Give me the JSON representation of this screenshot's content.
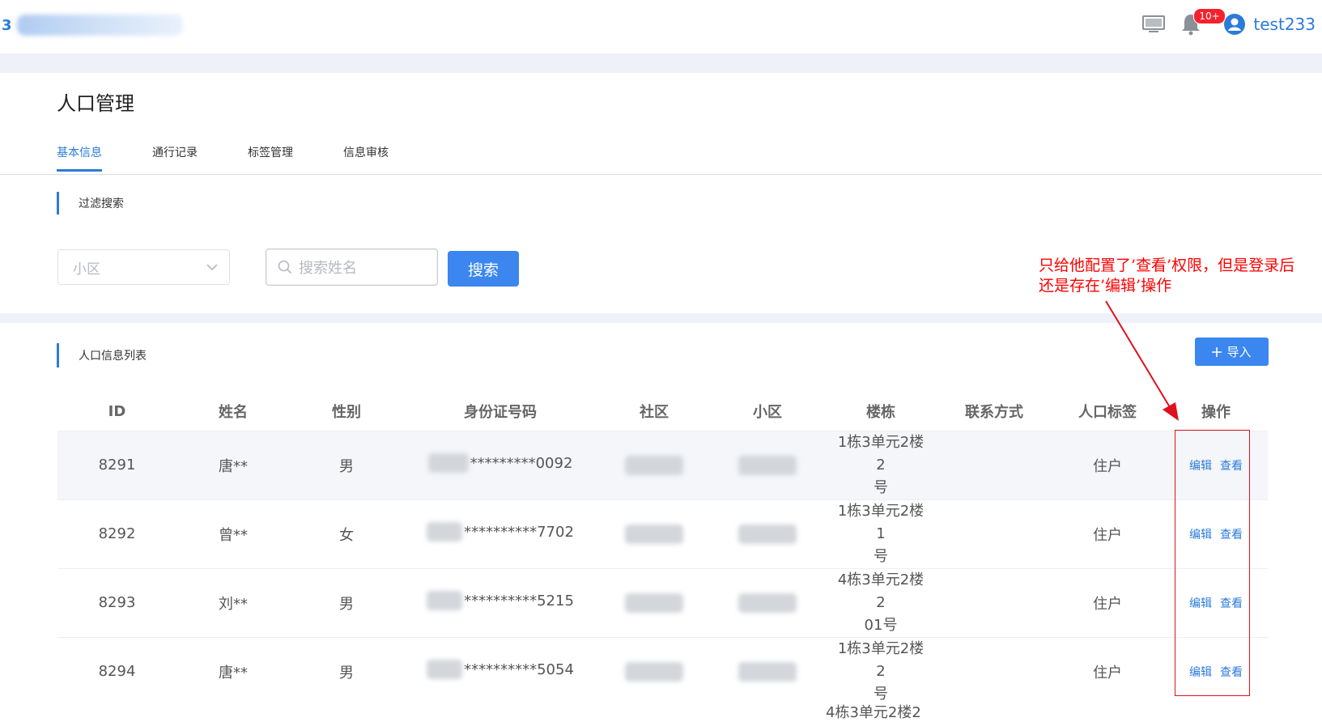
{
  "header": {
    "logo_text": "3",
    "badge": "10+",
    "username": "test233"
  },
  "page": {
    "title": "人口管理",
    "tabs": [
      "基本信息",
      "通行记录",
      "标签管理",
      "信息审核"
    ],
    "active_tab": 0
  },
  "filter": {
    "section_label": "过滤搜索",
    "community_placeholder": "小区",
    "name_placeholder": "搜索姓名",
    "search_button": "搜索"
  },
  "list": {
    "section_label": "人口信息列表",
    "import_button": "导入",
    "columns": [
      "ID",
      "姓名",
      "性别",
      "身份证号码",
      "社区",
      "小区",
      "楼栋",
      "联系方式",
      "人口标签",
      "操作"
    ],
    "rows": [
      {
        "id": "8291",
        "name": "唐**",
        "gender": "男",
        "idcard": "*********0092",
        "building_l1": "1栋3单元2楼2",
        "building_l2": "号",
        "contact": "",
        "tag": "住户",
        "edit": "编辑",
        "view": "查看"
      },
      {
        "id": "8292",
        "name": "曾**",
        "gender": "女",
        "idcard": "**********7702",
        "building_l1": "1栋3单元2楼1",
        "building_l2": "号",
        "contact": "",
        "tag": "住户",
        "edit": "编辑",
        "view": "查看"
      },
      {
        "id": "8293",
        "name": "刘**",
        "gender": "男",
        "idcard": "**********5215",
        "building_l1": "4栋3单元2楼2",
        "building_l2": "01号",
        "contact": "",
        "tag": "住户",
        "edit": "编辑",
        "view": "查看"
      },
      {
        "id": "8294",
        "name": "唐**",
        "gender": "男",
        "idcard": "**********5054",
        "building_l1": "1栋3单元2楼2",
        "building_l2": "号",
        "contact": "",
        "tag": "住户",
        "edit": "编辑",
        "view": "查看"
      }
    ],
    "partial_next_row": "4栋3单元2楼2"
  },
  "annotation": {
    "line1": "只给他配置了’查看’权限，但是登录后",
    "line2": "还是存在’编辑’操作",
    "color": "#ff0000"
  },
  "colors": {
    "accent": "#2b7bd9",
    "button": "#3b86ef",
    "band": "#eef2f8",
    "badge": "#f5222d"
  }
}
